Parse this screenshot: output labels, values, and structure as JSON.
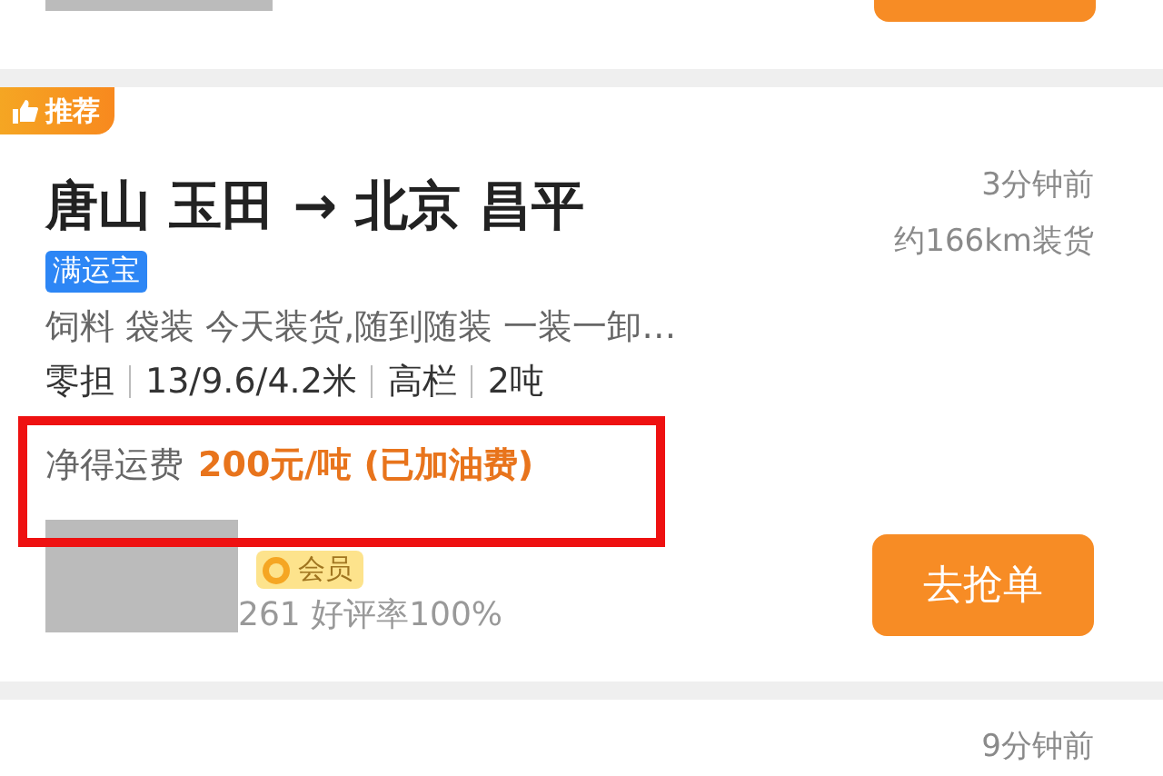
{
  "previous_card": {
    "kind": "partial"
  },
  "card": {
    "badge": "推荐",
    "time": "3分钟前",
    "distance": "约166km装货",
    "origin": "唐山 玉田",
    "arrow": "→",
    "destination": "北京 昌平",
    "tag": "满运宝",
    "description": "饲料 袋装 今天装货,随到随装 一装一卸…",
    "specs": [
      "零担",
      "13/9.6/4.2米",
      "高栏",
      "2吨"
    ],
    "fee_label": "净得运费",
    "fee": "200元/吨 (已加油费)",
    "highlighted": true,
    "member": "会员",
    "rating": "261 好评率100%",
    "button": "去抢单"
  },
  "next_card": {
    "time": "9分钟前"
  }
}
